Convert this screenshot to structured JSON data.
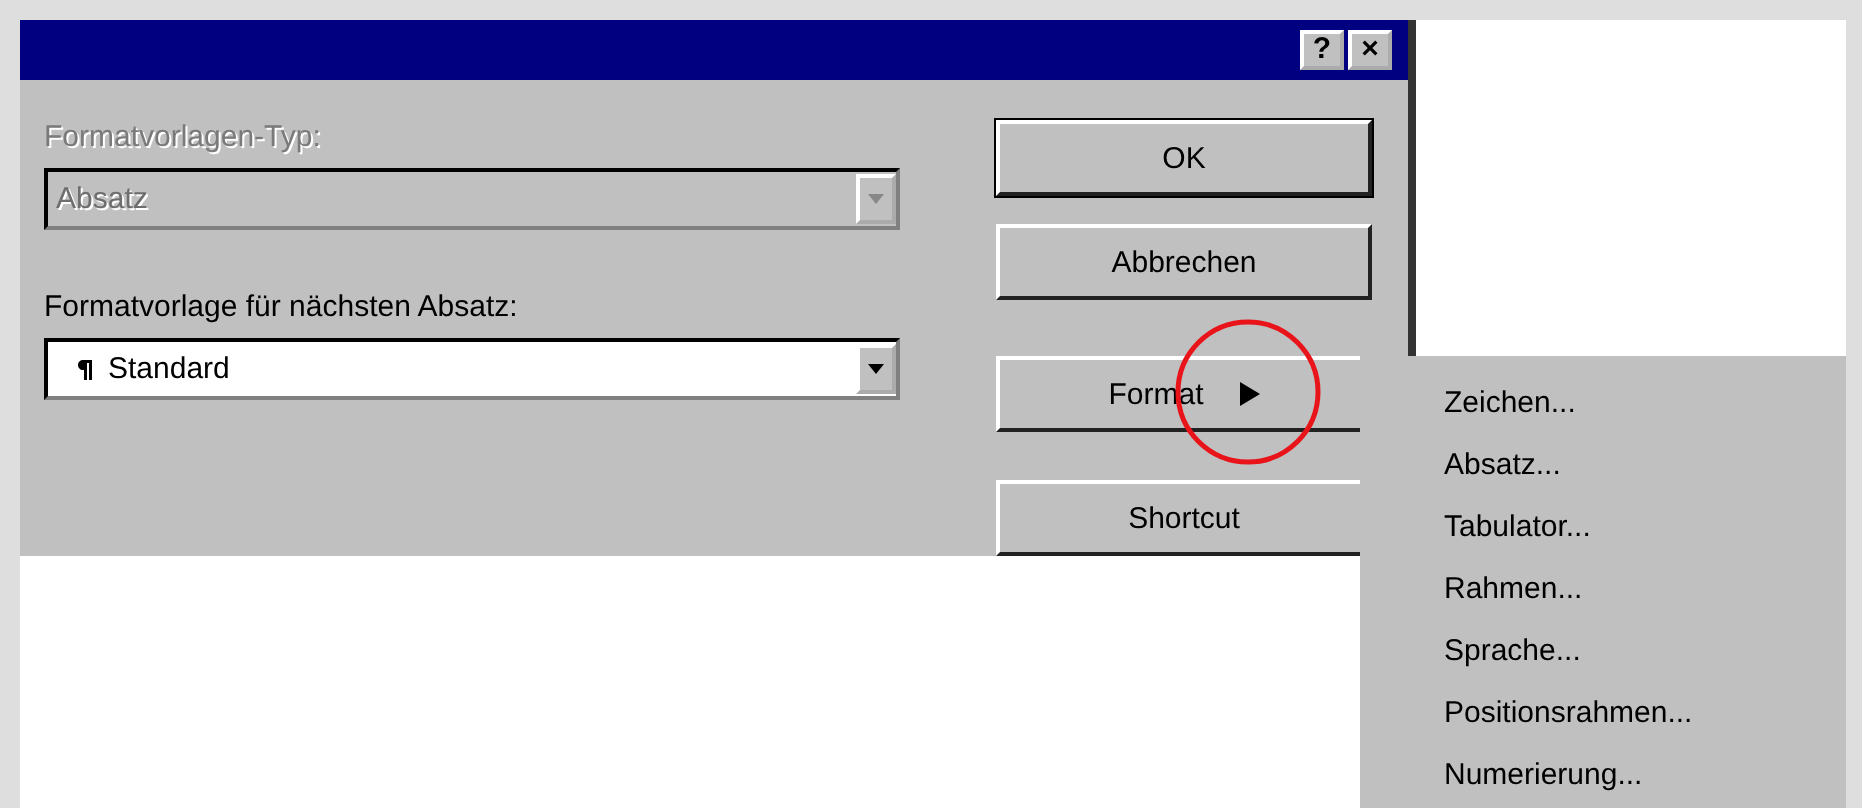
{
  "dialog": {
    "title_buttons": [
      "?",
      "×"
    ],
    "fields": [
      {
        "label": "Formatvorlagen-Typ:",
        "value": "Absatz",
        "disabled": true,
        "icon": false
      },
      {
        "label": "Formatvorlage für nächsten Absatz:",
        "value": "Standard",
        "disabled": false,
        "icon": true
      }
    ],
    "buttons": [
      {
        "label": "OK",
        "default": true,
        "submenu": false
      },
      {
        "label": "Abbrechen",
        "default": false,
        "submenu": false
      },
      {
        "label": "Format",
        "default": false,
        "submenu": true
      },
      {
        "label": "Shortcut",
        "default": false,
        "submenu": false
      }
    ]
  },
  "format_menu": {
    "items": [
      "Zeichen...",
      "Absatz...",
      "Tabulator...",
      "Rahmen...",
      "Sprache...",
      "Positionsrahmen...",
      "Numerierung..."
    ]
  }
}
